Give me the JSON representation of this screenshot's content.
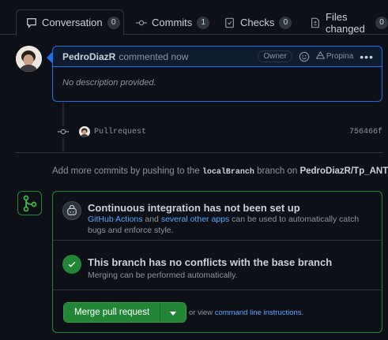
{
  "tabs": [
    {
      "label": "Conversation",
      "count": "0"
    },
    {
      "label": "Commits",
      "count": "1"
    },
    {
      "label": "Checks",
      "count": "0"
    },
    {
      "label": "Files changed",
      "count": "0"
    }
  ],
  "comment": {
    "author": "PedroDiazR",
    "action": "commented now",
    "badge": "Owner",
    "propina": "Propina",
    "body": "No description provided."
  },
  "commit": {
    "message": "Pullrequest",
    "sha": "756466f"
  },
  "add_commits": {
    "prefix": "Add more commits by pushing to the",
    "branch": "localBranch",
    "middle": "branch on",
    "repo": "PedroDiazR/Tp_ANT",
    "suffix": "."
  },
  "ci": {
    "title": "Continuous integration has not been set up",
    "link1": "GitHub Actions",
    "and": "and",
    "link2": "several other apps",
    "rest": "can be used to automatically catch bugs and enforce style."
  },
  "conflicts": {
    "title": "This branch has no conflicts with the base branch",
    "desc": "Merging can be performed automatically."
  },
  "merge": {
    "button": "Merge pull request",
    "or_view": "or view",
    "link": "command line instructions",
    "period": "."
  },
  "colors": {
    "accent_blue": "#1f6feb",
    "success_green": "#238636",
    "link": "#58a6ff"
  }
}
